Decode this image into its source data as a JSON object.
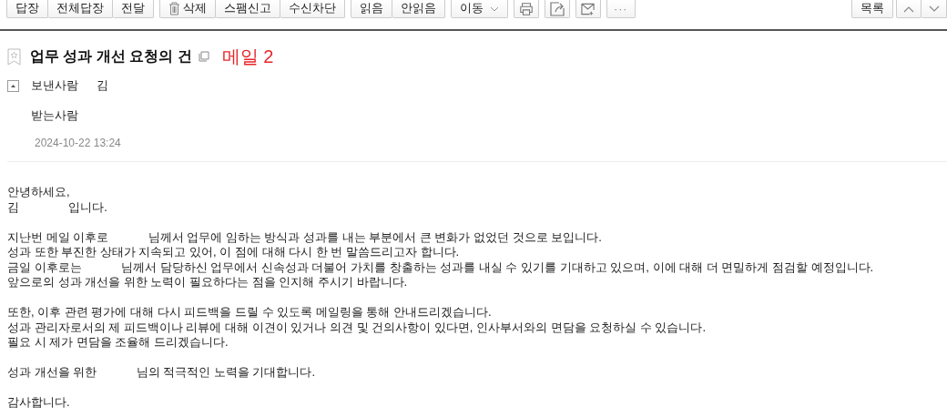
{
  "toolbar": {
    "groups": [
      [
        {
          "kind": "text",
          "label": "답장"
        },
        {
          "kind": "text",
          "label": "전체답장"
        },
        {
          "kind": "text",
          "label": "전달"
        }
      ],
      [
        {
          "kind": "trash",
          "label": "삭제"
        },
        {
          "kind": "text",
          "label": "스팸신고"
        },
        {
          "kind": "text",
          "label": "수신차단"
        }
      ],
      [
        {
          "kind": "text",
          "label": "읽음"
        },
        {
          "kind": "text",
          "label": "안읽음"
        }
      ],
      [
        {
          "kind": "dropdown",
          "label": "이동"
        }
      ],
      [
        {
          "kind": "print"
        }
      ],
      [
        {
          "kind": "share"
        }
      ],
      [
        {
          "kind": "mail"
        }
      ],
      [
        {
          "kind": "more",
          "label": "···"
        }
      ]
    ],
    "right": [
      [
        {
          "kind": "text",
          "label": "목록"
        }
      ],
      [
        {
          "kind": "up"
        },
        {
          "kind": "down"
        }
      ]
    ]
  },
  "header": {
    "subject": "업무 성과 개선 요청의 건",
    "annotation": "메일 2",
    "starred": false,
    "expanded": true,
    "sender_label": "보낸사람",
    "sender": "김",
    "recipient_label": "받는사람",
    "date": "2024-10-22 13:24"
  },
  "body": {
    "paragraphs": [
      [
        "안녕하세요,",
        "김               입니다."
      ],
      [
        "지난번 메일 이후로            님께서 업무에 임하는 방식과 성과를 내는 부분에서 큰 변화가 없었던 것으로 보입니다.",
        "성과 또한 부진한 상태가 지속되고 있어, 이 점에 대해 다시 한 번 말씀드리고자 합니다.",
        "금일 이후로는            님께서 담당하신 업무에서 신속성과 더불어 가치를 창출하는 성과를 내실 수 있기를 기대하고 있으며, 이에 대해 더 면밀하게 점검할 예정입니다.",
        "앞으로의 성과 개선을 위한 노력이 필요하다는 점을 인지해 주시기 바랍니다."
      ],
      [
        "또한, 이후 관련 평가에 대해 다시 피드백을 드릴 수 있도록 메일링을 통해 안내드리겠습니다.",
        "성과 관리자로서의 제 피드백이나 리뷰에 대해 이견이 있거나 의견 및 건의사항이 있다면, 인사부서와의 면담을 요청하실 수 있습니다.",
        "필요 시 제가 면담을 조율해 드리겠습니다."
      ],
      [
        "성과 개선을 위한            님의 적극적인 노력을 기대합니다."
      ],
      [
        "감사합니다."
      ]
    ]
  }
}
